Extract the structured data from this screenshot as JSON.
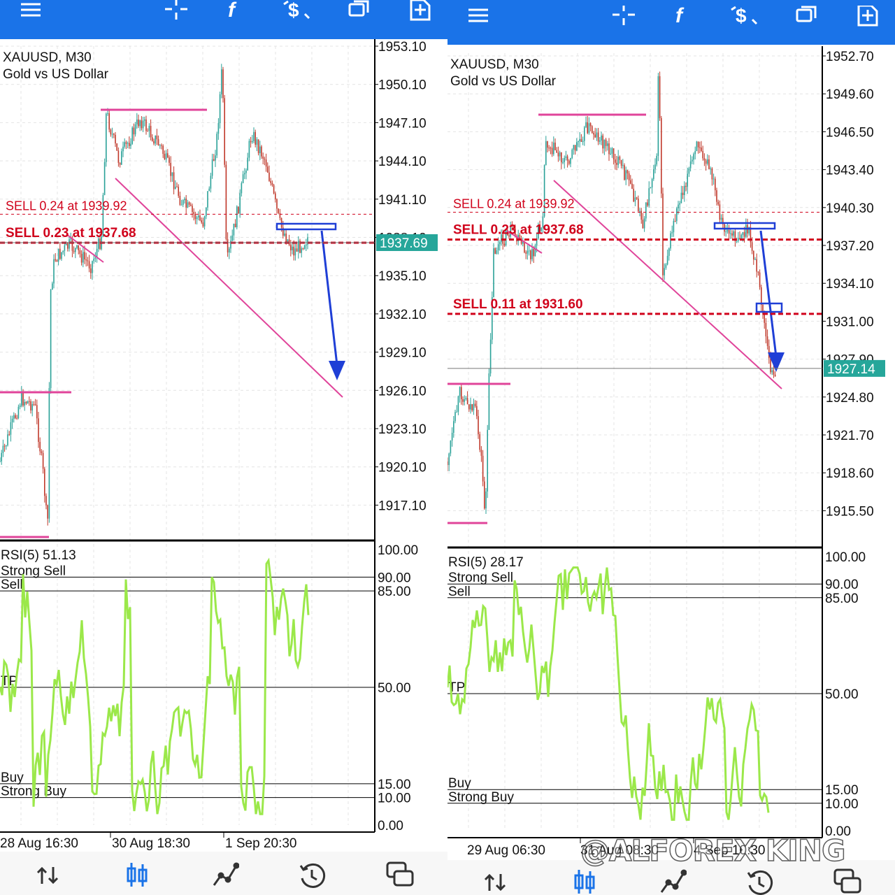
{
  "toolbar": {
    "icons": [
      "menu-icon",
      "crosshair-icon",
      "function-icon",
      "trade-dollar-icon",
      "windows-icon",
      "new-order-icon"
    ],
    "color": "#1a73e8"
  },
  "bottom_nav": {
    "items": [
      "quotes-icon",
      "chart-icon",
      "trade-icon",
      "history-icon",
      "messages-icon"
    ],
    "active": "chart-icon",
    "active_color": "#1a73e8"
  },
  "watermark": "@ALFOREX KING",
  "chart_data": [
    {
      "type": "candlestick",
      "symbol": "XAUUSD, M30",
      "description": "Gold vs US Dollar",
      "price_axis": [
        "1953.10",
        "1950.10",
        "1947.10",
        "1944.10",
        "1941.10",
        "1938.10",
        "1935.10",
        "1932.10",
        "1929.10",
        "1926.10",
        "1923.10",
        "1920.10",
        "1917.10"
      ],
      "current_price": "1937.69",
      "orders": [
        {
          "label": "SELL 0.24 at 1939.92",
          "price": 1939.92,
          "style": "thin-dashed"
        },
        {
          "label": "SELL 0.23 at 1937.68",
          "price": 1937.68,
          "style": "bold-dashed"
        }
      ],
      "time_labels": [
        "28 Aug 16:30",
        "30 Aug 18:30",
        "1 Sep 20:30"
      ],
      "rsi": {
        "label": "RSI(5) 51.13",
        "axis": [
          "100.00",
          "90.00",
          "85.00",
          "50.00",
          "15.00",
          "10.00",
          "0.00"
        ],
        "levels": [
          {
            "name": "Strong Sell",
            "value": 90
          },
          {
            "name": "Sell",
            "value": 85
          },
          {
            "name": "TP",
            "value": 50
          },
          {
            "name": "Buy",
            "value": 15
          },
          {
            "name": "Strong Buy",
            "value": 10
          }
        ],
        "color": "#9be84a"
      },
      "colors": {
        "up": "#2aa198",
        "down": "#c0392b",
        "trendline": "#e0449a",
        "order_line": "#d0021b",
        "arrow": "#1f3fd6",
        "price_tag": "#26a69a"
      }
    },
    {
      "type": "candlestick",
      "symbol": "XAUUSD, M30",
      "description": "Gold vs US Dollar",
      "price_axis": [
        "1952.70",
        "1949.60",
        "1946.50",
        "1943.40",
        "1940.30",
        "1937.20",
        "1934.10",
        "1931.00",
        "1927.90",
        "1924.80",
        "1921.70",
        "1918.60",
        "1915.50"
      ],
      "current_price": "1927.14",
      "orders": [
        {
          "label": "SELL 0.24 at 1939.92",
          "price": 1939.92,
          "style": "thin-dashed"
        },
        {
          "label": "SELL 0.23 at 1937.68",
          "price": 1937.68,
          "style": "bold-dashed"
        },
        {
          "label": "SELL 0.11 at 1931.60",
          "price": 1931.6,
          "style": "bold-dashed"
        }
      ],
      "time_labels": [
        "29 Aug 06:30",
        "31 Aug 08:30",
        "4 Sep 10:30"
      ],
      "rsi": {
        "label": "RSI(5) 28.17",
        "axis": [
          "100.00",
          "90.00",
          "85.00",
          "50.00",
          "15.00",
          "10.00",
          "0.00"
        ],
        "levels": [
          {
            "name": "Strong Sell",
            "value": 90
          },
          {
            "name": "Sell",
            "value": 85
          },
          {
            "name": "TP",
            "value": 50
          },
          {
            "name": "Buy",
            "value": 15
          },
          {
            "name": "Strong Buy",
            "value": 10
          }
        ],
        "color": "#9be84a"
      },
      "colors": {
        "up": "#2aa198",
        "down": "#c0392b",
        "trendline": "#e0449a",
        "order_line": "#d0021b",
        "arrow": "#1f3fd6",
        "price_tag": "#26a69a"
      }
    }
  ]
}
